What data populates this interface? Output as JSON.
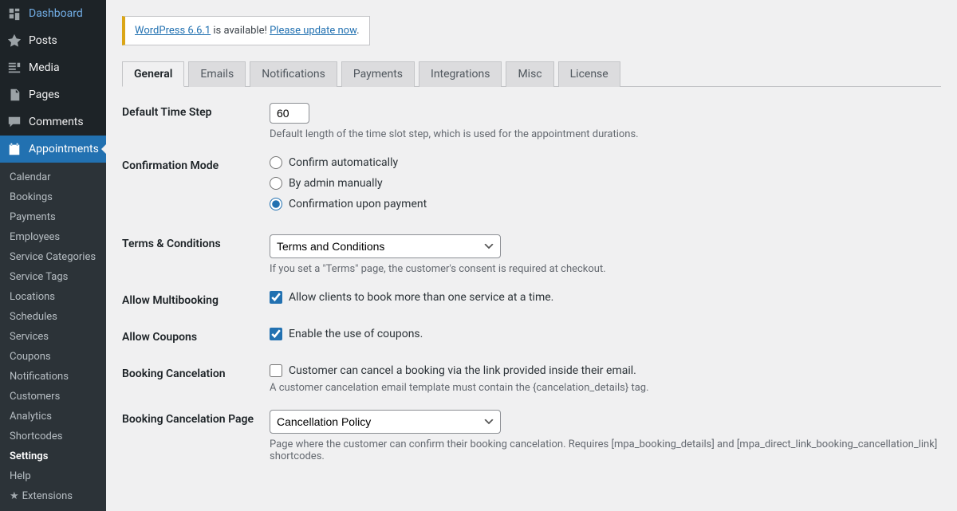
{
  "sidebar": {
    "main_items": [
      {
        "label": "Dashboard",
        "icon": "dashboard"
      },
      {
        "label": "Posts",
        "icon": "pin"
      },
      {
        "label": "Media",
        "icon": "media"
      },
      {
        "label": "Pages",
        "icon": "pages"
      },
      {
        "label": "Comments",
        "icon": "comments"
      },
      {
        "label": "Appointments",
        "icon": "calendar",
        "active": true
      }
    ],
    "sub_items": [
      {
        "label": "Calendar"
      },
      {
        "label": "Bookings"
      },
      {
        "label": "Payments"
      },
      {
        "label": "Employees"
      },
      {
        "label": "Service Categories"
      },
      {
        "label": "Service Tags"
      },
      {
        "label": "Locations"
      },
      {
        "label": "Schedules"
      },
      {
        "label": "Services"
      },
      {
        "label": "Coupons"
      },
      {
        "label": "Notifications"
      },
      {
        "label": "Customers"
      },
      {
        "label": "Analytics"
      },
      {
        "label": "Shortcodes"
      },
      {
        "label": "Settings",
        "current": true
      },
      {
        "label": "Help"
      },
      {
        "label": "Extensions",
        "icon": true
      }
    ]
  },
  "notice": {
    "link1": "WordPress 6.6.1",
    "middle": " is available! ",
    "link2": "Please update now",
    "end": "."
  },
  "tabs": [
    {
      "label": "General",
      "active": true
    },
    {
      "label": "Emails"
    },
    {
      "label": "Notifications"
    },
    {
      "label": "Payments"
    },
    {
      "label": "Integrations"
    },
    {
      "label": "Misc"
    },
    {
      "label": "License"
    }
  ],
  "form": {
    "time_step": {
      "label": "Default Time Step",
      "value": "60",
      "desc": "Default length of the time slot step, which is used for the appointment durations."
    },
    "confirmation": {
      "label": "Confirmation Mode",
      "options": [
        {
          "label": "Confirm automatically",
          "checked": false
        },
        {
          "label": "By admin manually",
          "checked": false
        },
        {
          "label": "Confirmation upon payment",
          "checked": true
        }
      ]
    },
    "terms": {
      "label": "Terms & Conditions",
      "selected": "Terms and Conditions",
      "desc": "If you set a \"Terms\" page, the customer's consent is required at checkout."
    },
    "multibooking": {
      "label": "Allow Multibooking",
      "option": "Allow clients to book more than one service at a time.",
      "checked": true
    },
    "coupons": {
      "label": "Allow Coupons",
      "option": "Enable the use of coupons.",
      "checked": true
    },
    "cancelation": {
      "label": "Booking Cancelation",
      "option": "Customer can cancel a booking via the link provided inside their email.",
      "checked": false,
      "desc": "A customer cancelation email template must contain the {cancelation_details} tag."
    },
    "cancelation_page": {
      "label": "Booking Cancelation Page",
      "selected": "Cancellation Policy",
      "desc": "Page where the customer can confirm their booking cancelation. Requires [mpa_booking_details] and [mpa_direct_link_booking_cancellation_link] shortcodes."
    }
  }
}
